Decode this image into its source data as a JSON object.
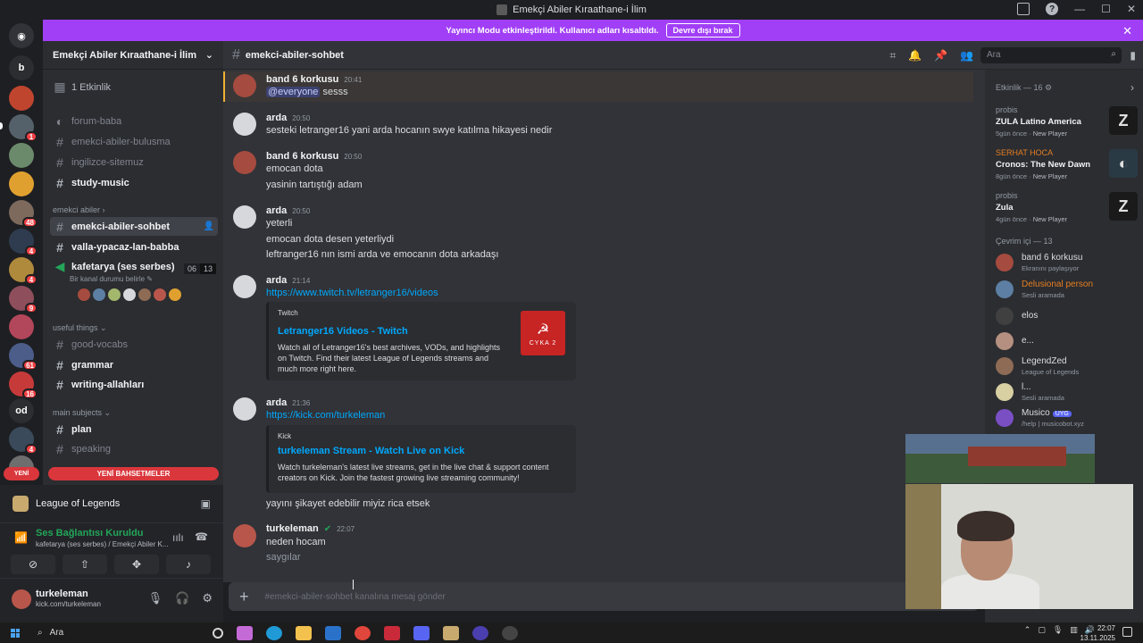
{
  "window": {
    "title": "Emekçi Abiler Kıraathane-i İlim"
  },
  "rail": {
    "dm_icon": "discord-icon",
    "letter_b": "b",
    "letter_od": "od",
    "badges": [
      "1",
      "48",
      "4",
      "4",
      "9",
      "61",
      "16",
      "4"
    ],
    "yeni": "YENİ"
  },
  "banner": {
    "text": "Yayıncı Modu etkinleştirildi. Kullanıcı adları kısaltıldı.",
    "button": "Devre dışı bırak",
    "close": "✕"
  },
  "sidebar": {
    "guild_name": "Emekçi Abiler Kıraathane-i İlim",
    "events": "1 Etkinlik",
    "channels_top": [
      {
        "name": "forum-baba",
        "state": "muted"
      },
      {
        "name": "emekci-abiler-bulusma",
        "state": "muted"
      },
      {
        "name": "ingilizce-sitemuz",
        "state": "muted"
      },
      {
        "name": "study-music",
        "state": "unread"
      }
    ],
    "category_emekci": "emekci abiler",
    "active_channel": "emekci-abiler-sohbet",
    "channel_valla": "valla-ypacaz-lan-babba",
    "voice_channel": "kafetarya (ses serbes)",
    "voice_status": "Bir kanal durumu belirle",
    "voice_count_a": "06",
    "voice_count_b": "13",
    "category_useful": "useful things",
    "channels_useful": [
      {
        "name": "good-vocabs",
        "state": "muted"
      },
      {
        "name": "grammar",
        "state": "unread"
      },
      {
        "name": "writing-allahları",
        "state": "unread"
      }
    ],
    "category_main": "main subjects",
    "channels_main": [
      {
        "name": "plan",
        "state": "unread"
      },
      {
        "name": "speaking",
        "state": "muted"
      }
    ],
    "new_mentions": "YENİ BAHSETMELER"
  },
  "activity_panel": {
    "game": "League of Legends"
  },
  "voice_panel": {
    "status": "Ses Bağlantısı Kuruldu",
    "location": "kafetarya (ses serbes) / Emekçi Abiler K..."
  },
  "user_panel": {
    "username": "turkeleman",
    "status": "kick.com/turkeleman"
  },
  "chat_header": {
    "channel": "emekci-abiler-sohbet",
    "search_placeholder": "Ara"
  },
  "messages": {
    "m1": {
      "author": "band 6 korkusu",
      "time": "20:41",
      "mention": "@everyone",
      "text": " sesss"
    },
    "m2": {
      "author": "arda",
      "time": "20:50",
      "text": "sesteki letranger16 yani arda hocanın swye katılma hikayesi nedir"
    },
    "m3": {
      "author": "band 6 korkusu",
      "time": "20:50",
      "l1": "emocan dota",
      "l2": "yasinin tartıştığı adam"
    },
    "m4": {
      "author": "arda",
      "time": "20:50",
      "l1": "yeterli",
      "l2": "emocan dota desen yeterliydi",
      "l3": "leftranger16 nın ismi arda ve emocanın dota arkadaşı"
    },
    "m5": {
      "author": "arda",
      "time": "21:14",
      "link": "https://www.twitch.tv/letranger16/videos",
      "embed": {
        "provider": "Twitch",
        "title": "Letranger16 Videos - Twitch",
        "desc": "Watch all of Letranger16's best archives, VODs, and highlights on Twitch. Find their latest League of Legends streams and much more right here.",
        "thumb_caption": "CYKA 2"
      }
    },
    "m6": {
      "author": "arda",
      "time": "21:36",
      "link": "https://kick.com/turkeleman",
      "embed": {
        "provider": "Kick",
        "title": "turkeleman Stream - Watch Live on Kick",
        "desc": "Watch turkeleman's latest live streams, get in the live chat & support content creators on Kick. Join the fastest growing live streaming community!"
      },
      "follow": "yayını şikayet edebilir miyiz rica etsek"
    },
    "m7": {
      "author": "turkeleman",
      "time": "22:07",
      "l1": "neden hocam",
      "l2": "saygılar"
    }
  },
  "composer": {
    "placeholder": "#emekci-abiler-sohbet kanalına mesaj gönder"
  },
  "members": {
    "activity_title": "Etkinlik — 16",
    "activities": [
      {
        "user": "probis",
        "game": "ZULA Latino America",
        "ago": "5gün önce",
        "tag": "New Player",
        "art": "Z"
      },
      {
        "user": "SERHAT HOCA",
        "game": "Cronos: The New Dawn",
        "ago": "8gün önce",
        "tag": "New Player",
        "art": "◐"
      },
      {
        "user": "probis",
        "game": "Zula",
        "ago": "4gün önce",
        "tag": "New Player",
        "art": "Z"
      }
    ],
    "online_title": "Çevrim içi — 13",
    "list": [
      {
        "name": "band 6 korkusu",
        "status": "Ekranını paylaşıyor"
      },
      {
        "name": "Delusional person",
        "status": "Sesli aramada"
      },
      {
        "name": "elos",
        "status": ""
      },
      {
        "name": "e...",
        "status": ""
      },
      {
        "name": "LegendZed",
        "status": "League of Legends"
      },
      {
        "name": "l...",
        "status": "Sesli aramada"
      },
      {
        "name": "Musico",
        "status": "/help | musicobot.xyz",
        "badge": "UYG"
      }
    ]
  },
  "taskbar": {
    "search": "Ara",
    "time": "22:07",
    "date": "13.11.2025"
  }
}
